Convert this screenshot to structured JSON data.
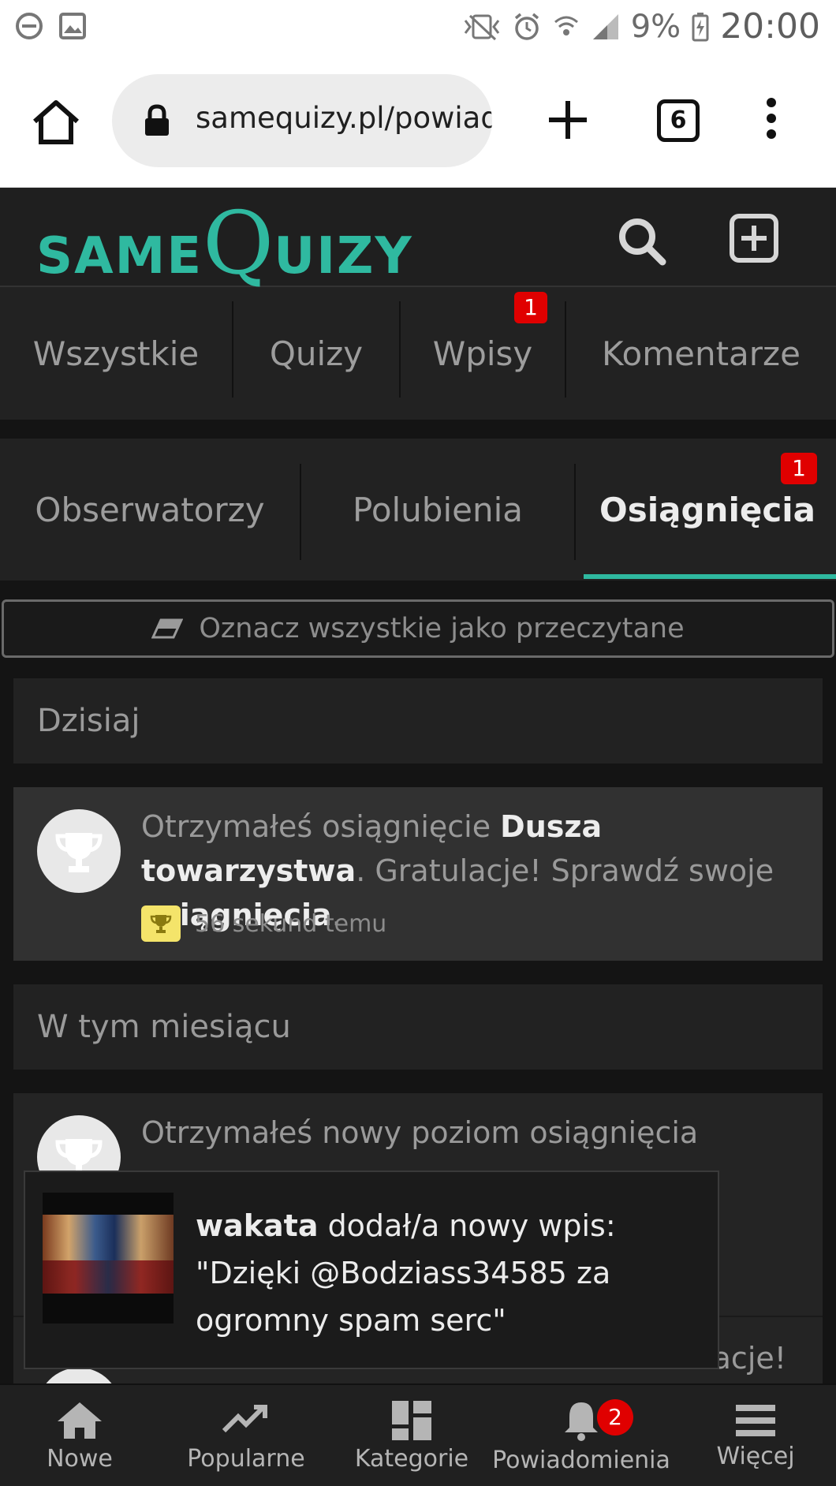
{
  "status_bar": {
    "battery": "9%",
    "time": "20:00"
  },
  "browser": {
    "url": "samequizy.pl/powiad",
    "tab_count": "6"
  },
  "site": {
    "logo_prefix": "SAME",
    "logo_q": "Q",
    "logo_suffix": "UIZY",
    "accent_color": "#2fb9a0"
  },
  "filters_row1": [
    {
      "label": "Wszystkie"
    },
    {
      "label": "Quizy"
    },
    {
      "label": "Wpisy",
      "badge": "1"
    },
    {
      "label": "Komentarze"
    }
  ],
  "filters_row2": [
    {
      "label": "Obserwatorzy"
    },
    {
      "label": "Polubienia"
    },
    {
      "label": "Osiągnięcia",
      "badge": "1",
      "active": true
    }
  ],
  "mark_all_read": "Oznacz wszystkie jako przeczytane",
  "sections": [
    {
      "title": "Dzisiaj",
      "notification": {
        "text_prefix": "Otrzymałeś osiągnięcie ",
        "achievement": "Dusza towarzystwa",
        "text_middle": ". Gratulacje! Sprawdź swoje ",
        "link": "osiągnięcia",
        "text_suffix": ".",
        "time": "56 sekund temu"
      }
    },
    {
      "title": "W tym miesiącu",
      "notification": {
        "text_visible": "Otrzymałeś nowy poziom osiągnięcia",
        "second_line_fragment": "acje!"
      }
    }
  ],
  "toast": {
    "user": "wakata",
    "message": " dodał/a nowy wpis: \"Dzięki @Bodziass34585 za ogromny spam serc\""
  },
  "bottom_nav": [
    {
      "label": "Nowe",
      "icon": "home-icon"
    },
    {
      "label": "Popularne",
      "icon": "trending-icon"
    },
    {
      "label": "Kategorie",
      "icon": "grid-icon"
    },
    {
      "label": "Powiadomienia",
      "icon": "bell-icon",
      "badge": "2"
    },
    {
      "label": "Więcej",
      "icon": "hamburger-icon"
    }
  ]
}
